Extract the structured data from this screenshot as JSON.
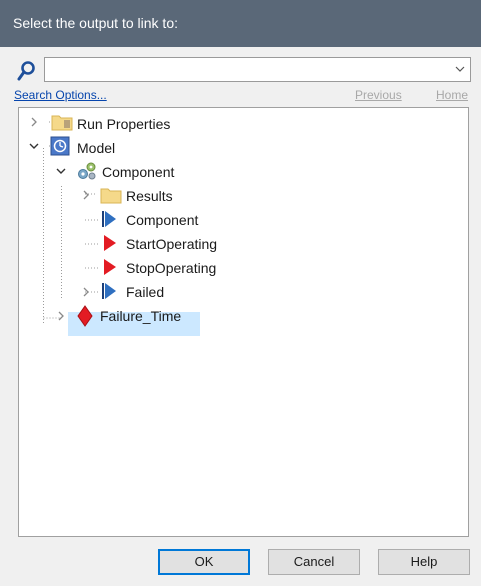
{
  "dialog": {
    "title": "Select the output to link to:"
  },
  "search": {
    "value": "",
    "options_label": "Search Options...",
    "previous_label": "Previous",
    "home_label": "Home"
  },
  "tree": {
    "items": [
      {
        "label": "Run Properties",
        "icon": "folder-icon",
        "expand": "collapsed",
        "depth": 0
      },
      {
        "label": "Model",
        "icon": "model-icon",
        "expand": "expanded",
        "depth": 0
      },
      {
        "label": "Component",
        "icon": "gears-icon",
        "expand": "expanded",
        "depth": 1
      },
      {
        "label": "Results",
        "icon": "folder-icon",
        "expand": "collapsed",
        "depth": 2
      },
      {
        "label": "Component",
        "icon": "blue-flag-icon",
        "expand": "none",
        "depth": 2
      },
      {
        "label": "StartOperating",
        "icon": "red-flag-icon",
        "expand": "none",
        "depth": 2
      },
      {
        "label": "StopOperating",
        "icon": "red-flag-icon",
        "expand": "none",
        "depth": 2
      },
      {
        "label": "Failed",
        "icon": "blue-flag-icon",
        "expand": "collapsed",
        "depth": 2
      },
      {
        "label": "Failure_Time",
        "icon": "red-diamond-icon",
        "expand": "collapsed",
        "depth": 1,
        "selected": true
      }
    ]
  },
  "buttons": {
    "ok": "OK",
    "cancel": "Cancel",
    "help": "Help"
  },
  "colors": {
    "title_bar": "#5a6878",
    "selection": "#cce8ff",
    "link": "#0645ad",
    "event_red": "#e31b23",
    "state_blue": "#2f6fc0"
  }
}
